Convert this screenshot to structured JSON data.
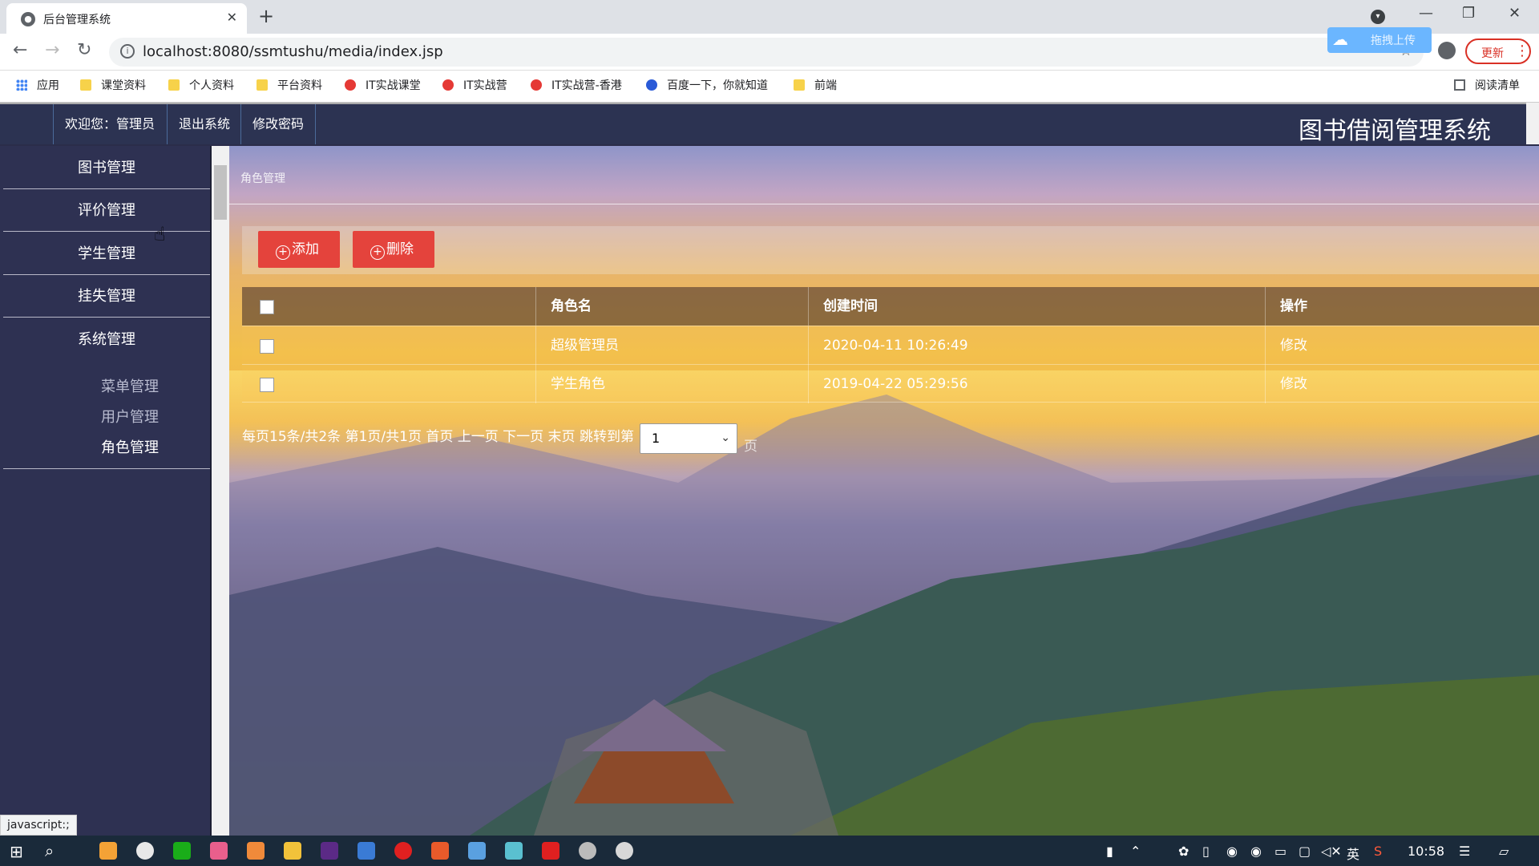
{
  "browser": {
    "tab_title": "后台管理系统",
    "tab_close": "✕",
    "new_tab": "+",
    "url": "localhost:8080/ssmtushu/media/index.jsp",
    "update_label": "更新",
    "baidu_upload_label": "拖拽上传",
    "bookmarks": [
      "应用",
      "课堂资料",
      "个人资料",
      "平台资料",
      "IT实战课堂",
      "IT实战营",
      "IT实战营-香港",
      "百度一下，你就知道",
      "前端"
    ],
    "reading_list": "阅读清单"
  },
  "header": {
    "welcome": "欢迎您：管理员",
    "logout": "退出系统",
    "change_password": "修改密码",
    "system_title": "图书借阅管理系统"
  },
  "sidebar": {
    "items": [
      "图书管理",
      "评价管理",
      "学生管理",
      "挂失管理",
      "系统管理"
    ],
    "sub_items": [
      "菜单管理",
      "用户管理",
      "角色管理"
    ]
  },
  "main": {
    "breadcrumb": "角色管理",
    "add_label": "添加",
    "delete_label": "删除",
    "table": {
      "columns": [
        "角色名",
        "创建时间",
        "操作"
      ],
      "rows": [
        {
          "name": "超级管理员",
          "created": "2020-04-11 10:26:49",
          "action": "修改"
        },
        {
          "name": "学生角色",
          "created": "2019-04-22 05:29:56",
          "action": "修改"
        }
      ]
    },
    "pager": {
      "text": "每页15条/共2条 第1页/共1页 首页 上一页 下一页 末页 跳转到第",
      "selected_page": "1",
      "suffix": "页"
    }
  },
  "status_tip": "javascript:;",
  "taskbar": {
    "clock": "10:58",
    "ime": "英"
  }
}
